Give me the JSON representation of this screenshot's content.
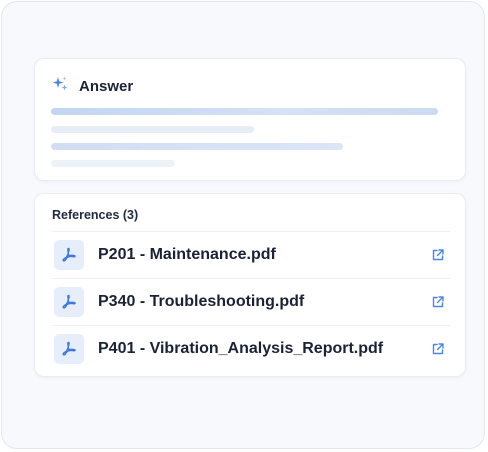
{
  "answer": {
    "title": "Answer",
    "icon": "sparkle-icon",
    "loading": true
  },
  "references": {
    "title": "References (3)",
    "items": [
      {
        "name": "P201 - Maintenance.pdf",
        "icon": "pdf-icon",
        "action_icon": "external-link-icon"
      },
      {
        "name": "P340 - Troubleshooting.pdf",
        "icon": "pdf-icon",
        "action_icon": "external-link-icon"
      },
      {
        "name": "P401 - Vibration_Analysis_Report.pdf",
        "icon": "pdf-icon",
        "action_icon": "external-link-icon"
      }
    ]
  },
  "colors": {
    "accent": "#4a86e8",
    "text": "#1a2236",
    "icon_bg": "#e6eefb"
  }
}
